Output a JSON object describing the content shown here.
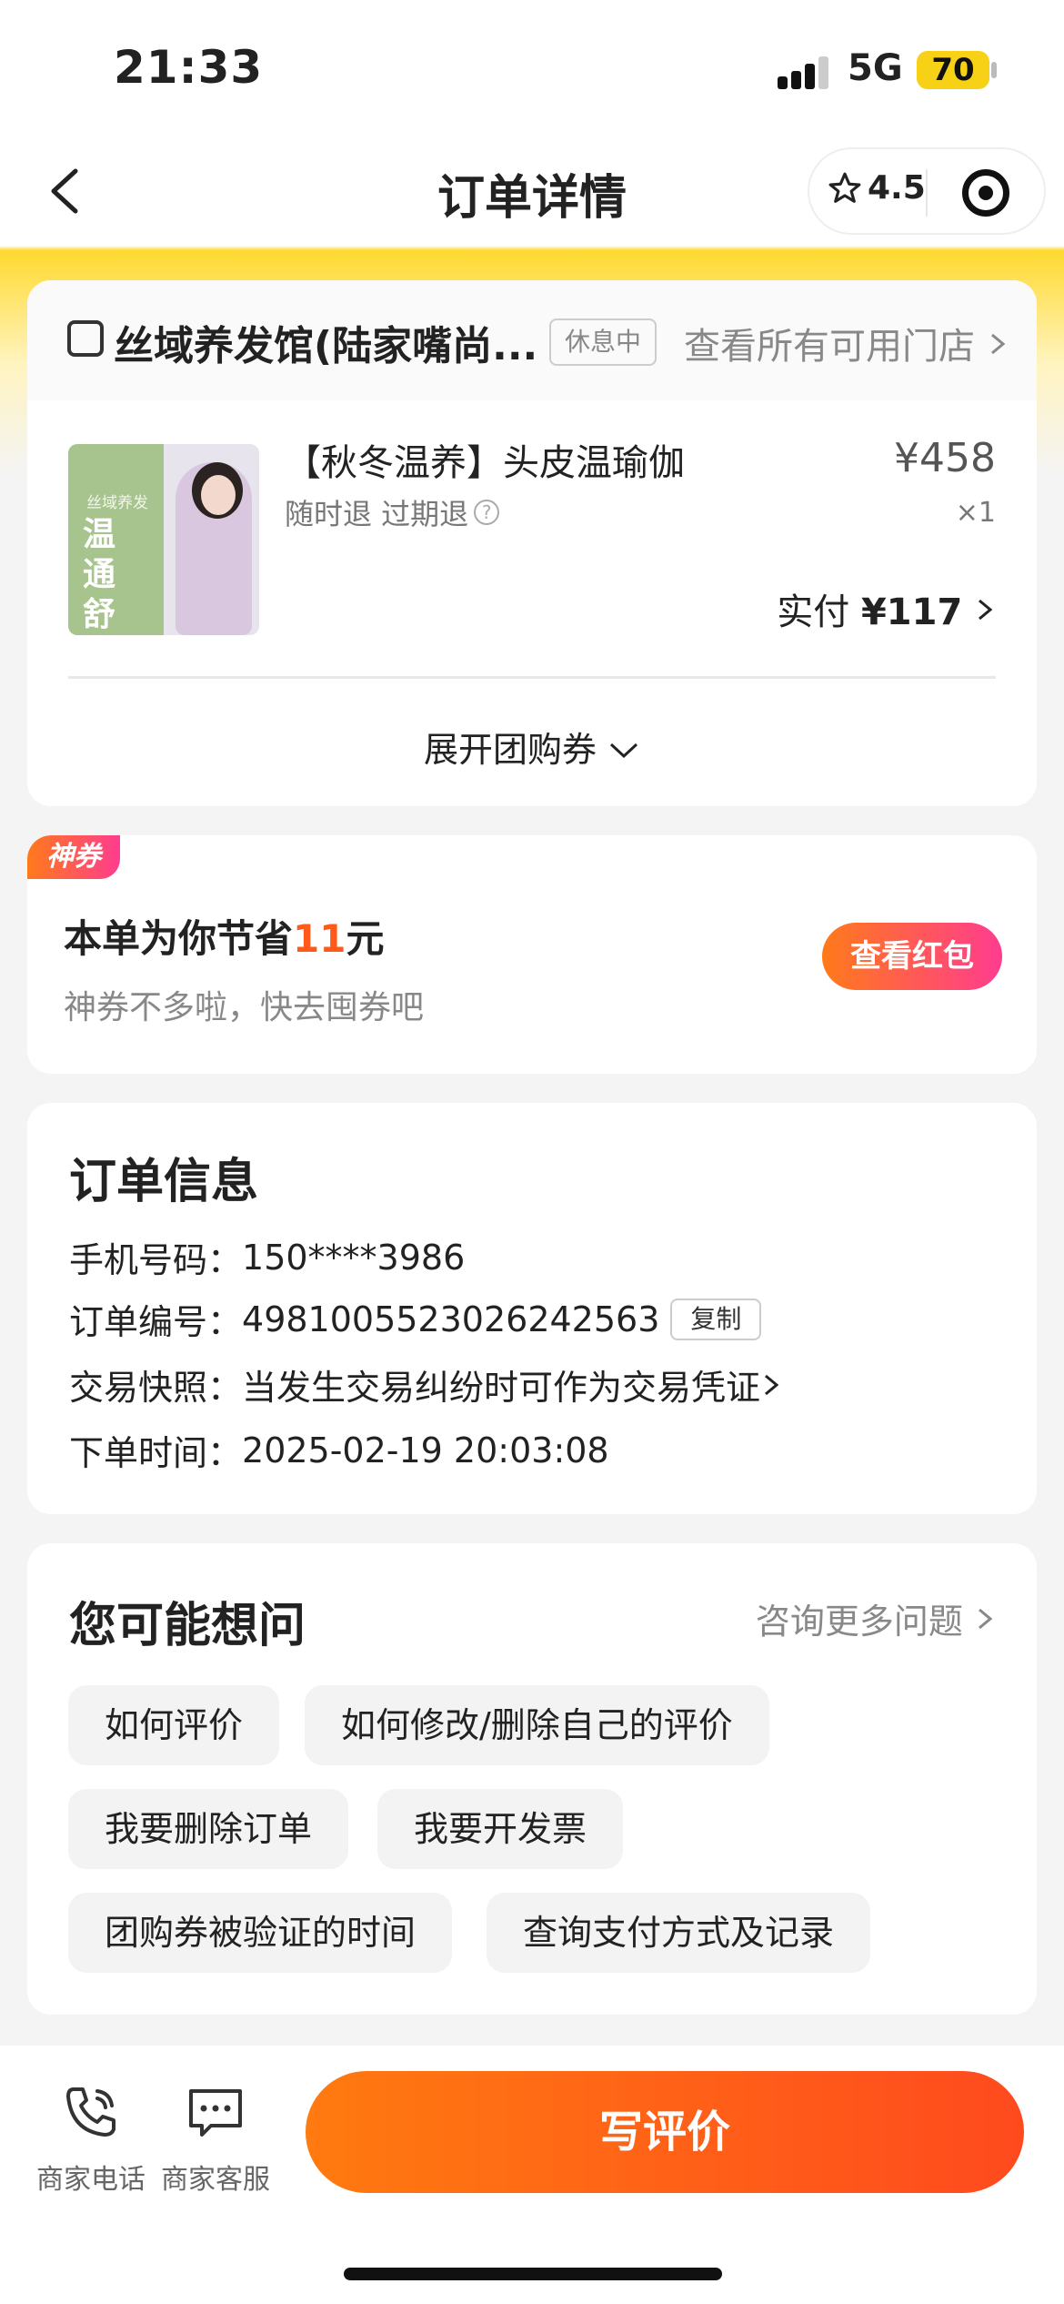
{
  "status_bar": {
    "time": "21:33",
    "network": "5G",
    "battery": "70"
  },
  "nav": {
    "title": "订单详情",
    "rating": "4.5",
    "back_icon": "chevron-left-icon"
  },
  "shop": {
    "name": "丝域养发馆(陆家嘴尚...",
    "status_tag": "休息中",
    "all_stores_link": "查看所有可用门店",
    "product": {
      "title": "【秋冬温养】头皮温瑜伽",
      "refund_policy": "随时退 过期退",
      "image_brand": "丝域养发",
      "image_slogan": "温通舒养",
      "price": "¥458",
      "quantity": "×1",
      "paid_label": "实付",
      "paid_amount": "¥117"
    },
    "expand_label": "展开团购券"
  },
  "savings": {
    "tag": "神券",
    "title_prefix": "本单为你节省",
    "amount": "11",
    "title_suffix": "元",
    "subtitle": "神券不多啦，快去囤券吧",
    "button": "查看红包"
  },
  "order_info": {
    "title": "订单信息",
    "rows": [
      {
        "label": "手机号码：",
        "value": "150****3986"
      },
      {
        "label": "订单编号：",
        "value": "4981005523026242563",
        "action": "复制"
      },
      {
        "label": "交易快照：",
        "value": "当发生交易纠纷时可作为交易凭证"
      },
      {
        "label": "下单时间：",
        "value": "2025-02-19 20:03:08"
      }
    ]
  },
  "faq": {
    "title": "您可能想问",
    "more_link": "咨询更多问题",
    "chips": [
      "如何评价",
      "如何修改/删除自己的评价",
      "我要删除订单",
      "我要开发票",
      "团购券被验证的时间",
      "查询支付方式及记录"
    ]
  },
  "bottom_bar": {
    "phone_label": "商家电话",
    "chat_label": "商家客服",
    "review_button": "写评价"
  },
  "colors": {
    "accent_orange": "#ff5a1a",
    "brand_yellow": "#ffd92f",
    "pink": "#ff3c8f"
  }
}
